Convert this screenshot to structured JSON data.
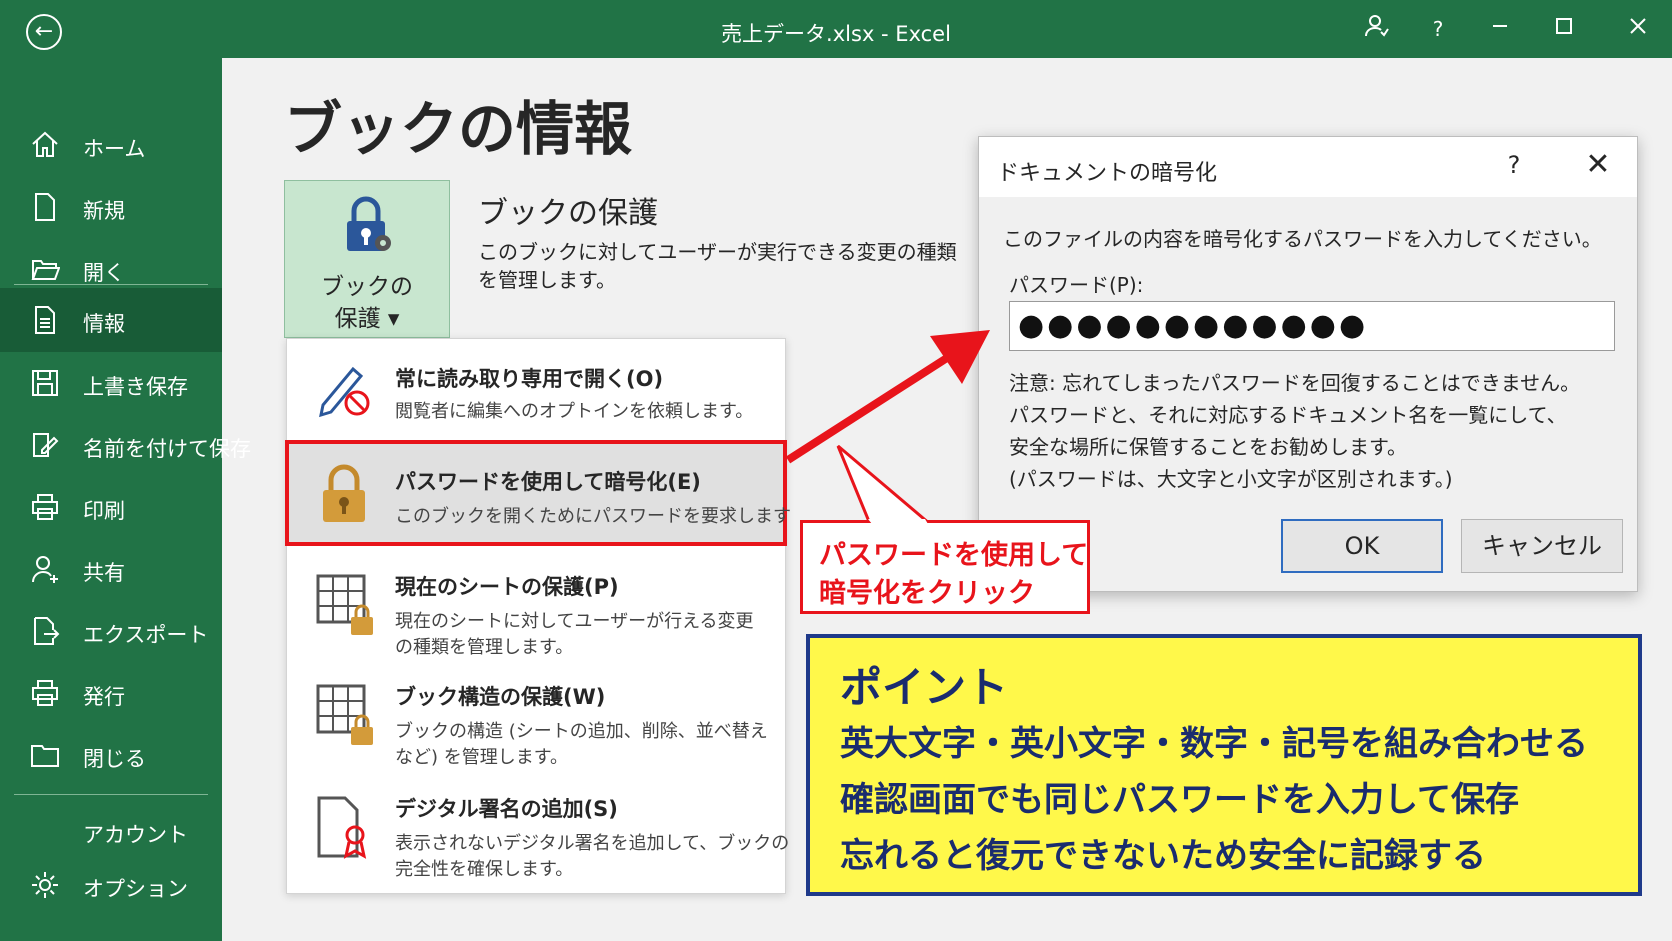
{
  "titlebar": {
    "title": "売上データ.xlsx  -  Excel",
    "back_icon": "arrow-left-icon",
    "icons": [
      "account-icon",
      "help-icon",
      "minimize-icon",
      "maximize-icon",
      "close-icon"
    ],
    "help_glyph": "?"
  },
  "sidebar": {
    "items": [
      {
        "label": "ホーム",
        "icon": "home-icon"
      },
      {
        "label": "新規",
        "icon": "new-file-icon"
      },
      {
        "label": "開く",
        "icon": "folder-open-icon"
      },
      {
        "label": "情報",
        "icon": "info-document-icon"
      },
      {
        "label": "上書き保存",
        "icon": "save-icon"
      },
      {
        "label": "名前を付けて保存",
        "icon": "save-as-icon"
      },
      {
        "label": "印刷",
        "icon": "printer-icon"
      },
      {
        "label": "共有",
        "icon": "share-person-icon"
      },
      {
        "label": "エクスポート",
        "icon": "export-icon"
      },
      {
        "label": "発行",
        "icon": "publish-icon"
      },
      {
        "label": "閉じる",
        "icon": "folder-close-icon"
      },
      {
        "label": "アカウント",
        "icon": ""
      },
      {
        "label": "オプション",
        "icon": "gear-icon"
      }
    ],
    "active": "情報"
  },
  "main": {
    "page_title": "ブックの情報",
    "protect_button": {
      "line1": "ブックの",
      "line2": "保護 ▾"
    },
    "section_title": "ブックの保護",
    "section_desc_1": "このブックに対してユーザーが実行できる変更の種類",
    "section_desc_2": "を管理します。"
  },
  "menu": {
    "items": [
      {
        "title": "常に読み取り専用で開く(O)",
        "desc": [
          "閲覧者に編集へのオプトインを依頼します。"
        ],
        "icon": "read-only-pencil-icon"
      },
      {
        "title": "パスワードを使用して暗号化(E)",
        "desc": [
          "このブックを開くためにパスワードを要求します"
        ],
        "icon": "lock-icon",
        "highlighted": true
      },
      {
        "title": "現在のシートの保護(P)",
        "desc": [
          "現在のシートに対してユーザーが行える変更",
          "の種類を管理します。"
        ],
        "icon": "sheet-lock-icon"
      },
      {
        "title": "ブック構造の保護(W)",
        "desc": [
          "ブックの構造 (シートの追加、削除、並べ替え",
          "など) を管理します。"
        ],
        "icon": "workbook-lock-icon"
      },
      {
        "title": "デジタル署名の追加(S)",
        "desc": [
          "表示されないデジタル署名を追加して、ブックの",
          "完全性を確保します。"
        ],
        "icon": "certificate-icon"
      }
    ]
  },
  "dialog": {
    "title": "ドキュメントの暗号化",
    "help": "?",
    "close": "✕",
    "instruction": "このファイルの内容を暗号化するパスワードを入力してください。",
    "password_label": "パスワード(P):",
    "password_value": "●●●●●●●●●●●●",
    "warning_lines": [
      "注意: 忘れてしまったパスワードを回復することはできません。",
      "パスワードと、それに対応するドキュメント名を一覧にして、",
      "安全な場所に保管することをお勧めします。",
      "(パスワードは、大文字と小文字が区別されます。)"
    ],
    "ok": "OK",
    "cancel": "キャンセル"
  },
  "callout": {
    "line1": "パスワードを使用して",
    "line2": "暗号化をクリック",
    "color": "#e8141b"
  },
  "point": {
    "title": "ポイント",
    "lines": [
      "英大文字・英小文字・数字・記号を組み合わせる",
      "確認画面でも同じパスワードを入力して保存",
      "忘れると復元できないため安全に記録する"
    ],
    "bg_color": "#fff84a",
    "text_color": "#1a2c6e"
  },
  "colors": {
    "excel_green": "#217346",
    "active_green": "#185c37",
    "accent_red": "#e8141b"
  }
}
